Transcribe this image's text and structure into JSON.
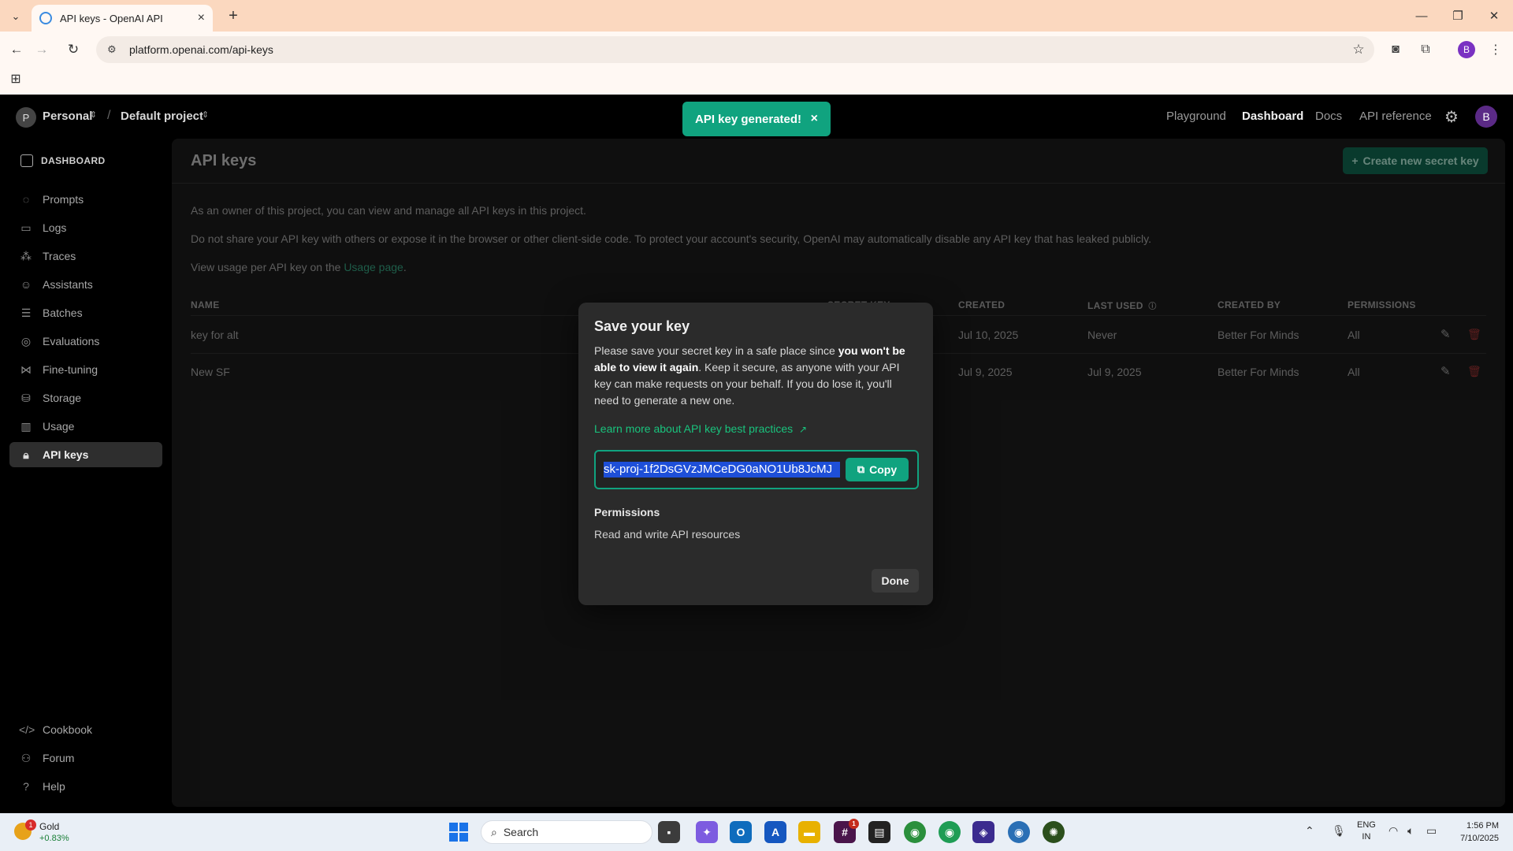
{
  "browser": {
    "tab_title": "API keys - OpenAI API",
    "url": "platform.openai.com/api-keys",
    "profile_initial": "B"
  },
  "header": {
    "org_initial": "P",
    "org_name": "Personal",
    "project_name": "Default project",
    "nav": [
      "Playground",
      "Dashboard",
      "Docs",
      "API reference"
    ],
    "active_nav": "Dashboard",
    "user_initial": "B"
  },
  "toast": {
    "message": "API key generated!",
    "close": "×"
  },
  "sidebar": {
    "title": "DASHBOARD",
    "items": [
      {
        "label": "Prompts",
        "icon": "chat-bubble-icon"
      },
      {
        "label": "Logs",
        "icon": "logs-icon"
      },
      {
        "label": "Traces",
        "icon": "traces-icon"
      },
      {
        "label": "Assistants",
        "icon": "assistant-icon"
      },
      {
        "label": "Batches",
        "icon": "batches-icon"
      },
      {
        "label": "Evaluations",
        "icon": "evaluations-icon"
      },
      {
        "label": "Fine-tuning",
        "icon": "fine-tuning-icon"
      },
      {
        "label": "Storage",
        "icon": "storage-icon"
      },
      {
        "label": "Usage",
        "icon": "usage-icon"
      },
      {
        "label": "API keys",
        "icon": "lock-icon"
      }
    ],
    "footer": [
      {
        "label": "Cookbook",
        "icon": "code-icon"
      },
      {
        "label": "Forum",
        "icon": "people-icon"
      },
      {
        "label": "Help",
        "icon": "help-icon"
      }
    ]
  },
  "main": {
    "title": "API keys",
    "create_button": "Create new secret key",
    "para1": "As an owner of this project, you can view and manage all API keys in this project.",
    "para2": "Do not share your API key with others or expose it in the browser or other client-side code. To protect your account's security, OpenAI may automatically disable any API key that has leaked publicly.",
    "para3_prefix": "View usage per API key on the ",
    "para3_link": "Usage page",
    "para3_suffix": ".",
    "table": {
      "headers": [
        "NAME",
        "SECRET KEY",
        "CREATED",
        "LAST USED",
        "CREATED BY",
        "PERMISSIONS"
      ],
      "rows": [
        {
          "name": "key for alt",
          "created": "Jul 10, 2025",
          "last_used": "Never",
          "created_by": "Better For Minds",
          "permissions": "All"
        },
        {
          "name": "New SF",
          "created": "Jul 9, 2025",
          "last_used": "Jul 9, 2025",
          "created_by": "Better For Minds",
          "permissions": "All"
        }
      ]
    }
  },
  "modal": {
    "title": "Save your key",
    "body_part1": "Please save your secret key in a safe place since ",
    "body_bold": "you won't be able to view it again",
    "body_part2": ". Keep it secure, as anyone with your API key can make requests on your behalf. If you do lose it, you'll need to generate a new one.",
    "learn_link": "Learn more about API key best practices",
    "key_value": "sk-proj-1f2DsGVzJMCeDG0aNO1Ub8JcMJ",
    "copy_label": "Copy",
    "permissions_heading": "Permissions",
    "permissions_value": "Read and write API resources",
    "done_label": "Done"
  },
  "taskbar": {
    "weather_name": "Gold",
    "weather_value": "+0.83%",
    "weather_badge": "1",
    "search_placeholder": "Search",
    "lang_line1": "ENG",
    "lang_line2": "IN",
    "time": "1:56 PM",
    "date": "7/10/2025"
  },
  "colors": {
    "accent": "#10a37f",
    "background": "#000000",
    "panel": "#181818",
    "modal": "#2b2b2b"
  }
}
